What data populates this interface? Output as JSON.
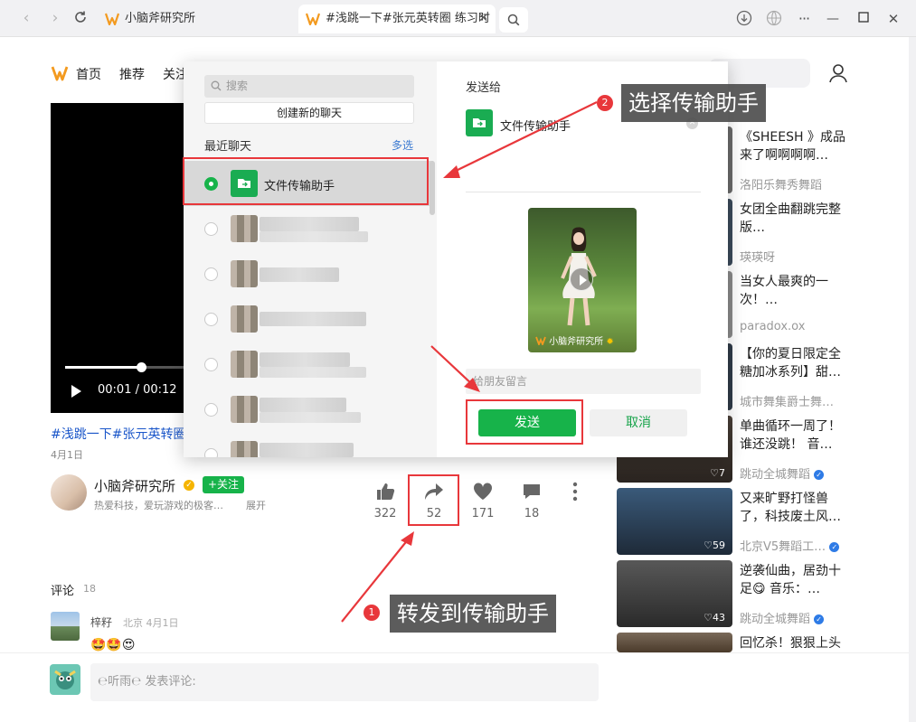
{
  "browser": {
    "tabs": [
      {
        "title": "小脑斧研究所",
        "active": false
      },
      {
        "title": "#浅跳一下#张元英转圈 练习时",
        "active": true
      }
    ]
  },
  "topnav": {
    "items": [
      "首页",
      "推荐",
      "关注"
    ]
  },
  "video": {
    "time": "00:01 / 00:12",
    "progress": 0.083,
    "title": "#浅跳一下#张元英转圈",
    "date": "4月1日"
  },
  "author": {
    "name": "小脑斧研究所",
    "follow_label": "+关注",
    "desc": "热爱科技，爱玩游戏的极客…",
    "expand_label": "展开"
  },
  "actions": {
    "like_count": "322",
    "share_count": "52",
    "fav_count": "171",
    "comment_count": "18"
  },
  "comments": {
    "label": "评论",
    "count": "18",
    "items": [
      {
        "name": "梓籽",
        "meta": "北京 4月1日",
        "emoji": "🤩🤩😍"
      }
    ]
  },
  "comment_input": {
    "placeholder": "发表评论:",
    "user": "℮听雨℮"
  },
  "recommendations": [
    {
      "title": "《SHEESH 》成品来了啊啊啊啊…",
      "author": "洛阳乐舞秀舞蹈",
      "likes": "",
      "verified": false
    },
    {
      "title": "女团全曲翻跳完整版…",
      "author": "瑛瑛呀",
      "likes": "",
      "verified": false
    },
    {
      "title": "当女人最爽的一次！…",
      "author": "paradox.ox",
      "likes": "",
      "verified": false
    },
    {
      "title": "【你的夏日限定全糖加冰系列】甜…",
      "author": "城市舞集爵士舞…",
      "likes": "",
      "verified": false
    },
    {
      "title": "单曲循环一周了！谁还没跳！ 音…",
      "author": "跳动全城舞蹈",
      "likes": "7",
      "verified": true
    },
    {
      "title": "又来旷野打怪兽了，科技废土风…",
      "author": "北京V5舞蹈工…",
      "likes": "59",
      "verified": true
    },
    {
      "title": "逆袭仙曲，居劲十足😋 音乐：…",
      "author": "跳动全城舞蹈",
      "likes": "43",
      "verified": true
    },
    {
      "title": "回忆杀！狠狠上头",
      "author": "",
      "likes": "",
      "verified": false
    }
  ],
  "share_dialog": {
    "search_placeholder": "搜索",
    "new_chat_label": "创建新的聊天",
    "recent_label": "最近聊天",
    "multi_select_label": "多选",
    "selected_chat": "文件传输助手",
    "send_to_label": "发送给",
    "target_name": "文件传输助手",
    "preview_watermark": "小脑斧研究所",
    "message_placeholder": "给朋友留言",
    "send_label": "发送",
    "cancel_label": "取消"
  },
  "annotations": {
    "step1": {
      "number": "1",
      "text": "转发到传输助手"
    },
    "step2": {
      "number": "2",
      "text": "选择传输助手"
    }
  },
  "colors": {
    "accent_green": "#17b34a",
    "annotation_red": "#e8373b",
    "link_blue": "#1a56c9"
  }
}
